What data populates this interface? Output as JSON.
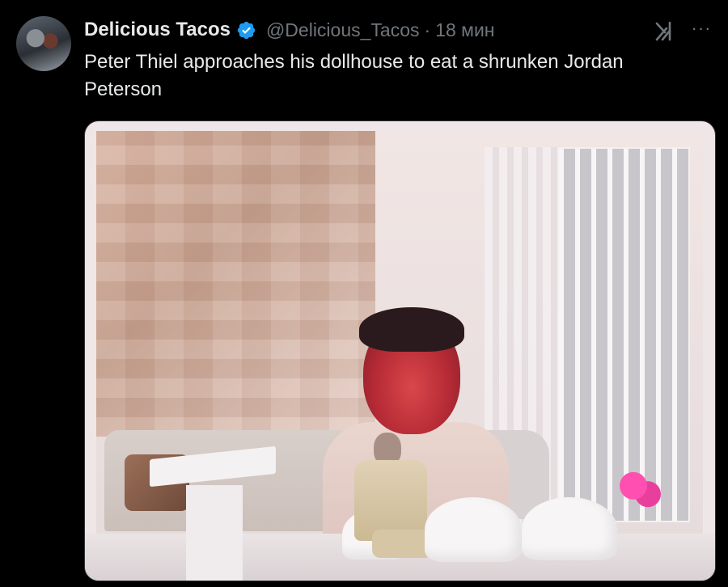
{
  "tweet": {
    "author_name": "Delicious Tacos",
    "handle": "@Delicious_Tacos",
    "separator": "·",
    "time": "18 мин",
    "text": "Peter Thiel approaches his dollhouse to eat a shrunken Jordan Peterson",
    "more_label": "···"
  },
  "colors": {
    "background": "#000000",
    "text_primary": "#e7e9ea",
    "text_secondary": "#71767b",
    "verified_blue": "#1d9bf0"
  },
  "icons": [
    "avatar",
    "verified-badge-icon",
    "grok-icon",
    "more-icon"
  ]
}
